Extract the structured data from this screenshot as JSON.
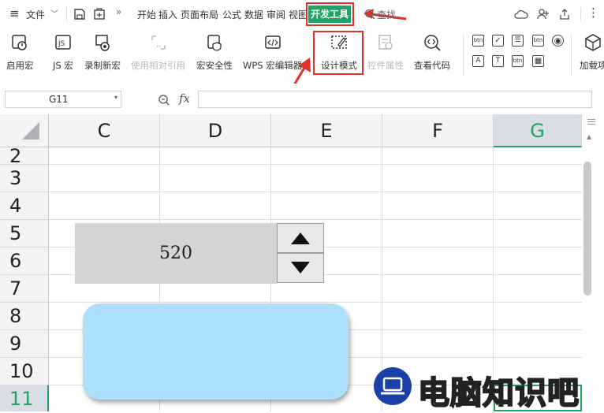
{
  "menubar": {
    "file_label": "文件",
    "tabs": [
      "开始",
      "插入",
      "页面布局",
      "公式",
      "数据",
      "审阅",
      "视图"
    ],
    "active_tab": "开发工具",
    "search_label": "查找"
  },
  "ribbon": {
    "buttons": [
      {
        "label": "启用宏",
        "icon": "macro-enable-icon",
        "enabled": true
      },
      {
        "label": "JS 宏",
        "icon": "js-macro-icon",
        "enabled": true
      },
      {
        "label": "录制新宏",
        "icon": "record-macro-icon",
        "enabled": true
      },
      {
        "label": "使用相对引用",
        "icon": "relative-ref-icon",
        "enabled": false
      },
      {
        "label": "宏安全性",
        "icon": "macro-security-icon",
        "enabled": true
      },
      {
        "label": "WPS 宏编辑器",
        "icon": "macro-editor-icon",
        "enabled": true
      },
      {
        "label": "设计模式",
        "icon": "design-mode-icon",
        "enabled": true
      },
      {
        "label": "控件属性",
        "icon": "control-properties-icon",
        "enabled": false
      },
      {
        "label": "查看代码",
        "icon": "view-code-icon",
        "enabled": true
      },
      {
        "label": "加载项",
        "icon": "addins-icon",
        "enabled": true
      }
    ],
    "controls_row1": [
      "btn",
      "✓",
      "☰",
      "btn",
      "◉"
    ],
    "controls_row2": [
      "A",
      "T",
      "btn",
      "▦",
      ""
    ]
  },
  "formula_bar": {
    "cell_ref": "G11",
    "fx_label": "fx",
    "formula": ""
  },
  "sheet": {
    "columns": [
      "C",
      "D",
      "E",
      "F",
      "G"
    ],
    "selected_column": "G",
    "rows": [
      "2",
      "3",
      "4",
      "5",
      "6",
      "7",
      "8",
      "9",
      "10",
      "11"
    ],
    "selected_row": "11"
  },
  "spinner": {
    "value": "520"
  },
  "watermark": {
    "text": "电脑知识吧"
  },
  "colors": {
    "accent_green": "#1fa463",
    "highlight_red": "#e0312b",
    "spinner_bg": "#d4d4d4",
    "shape_blue": "#ade0fc"
  }
}
